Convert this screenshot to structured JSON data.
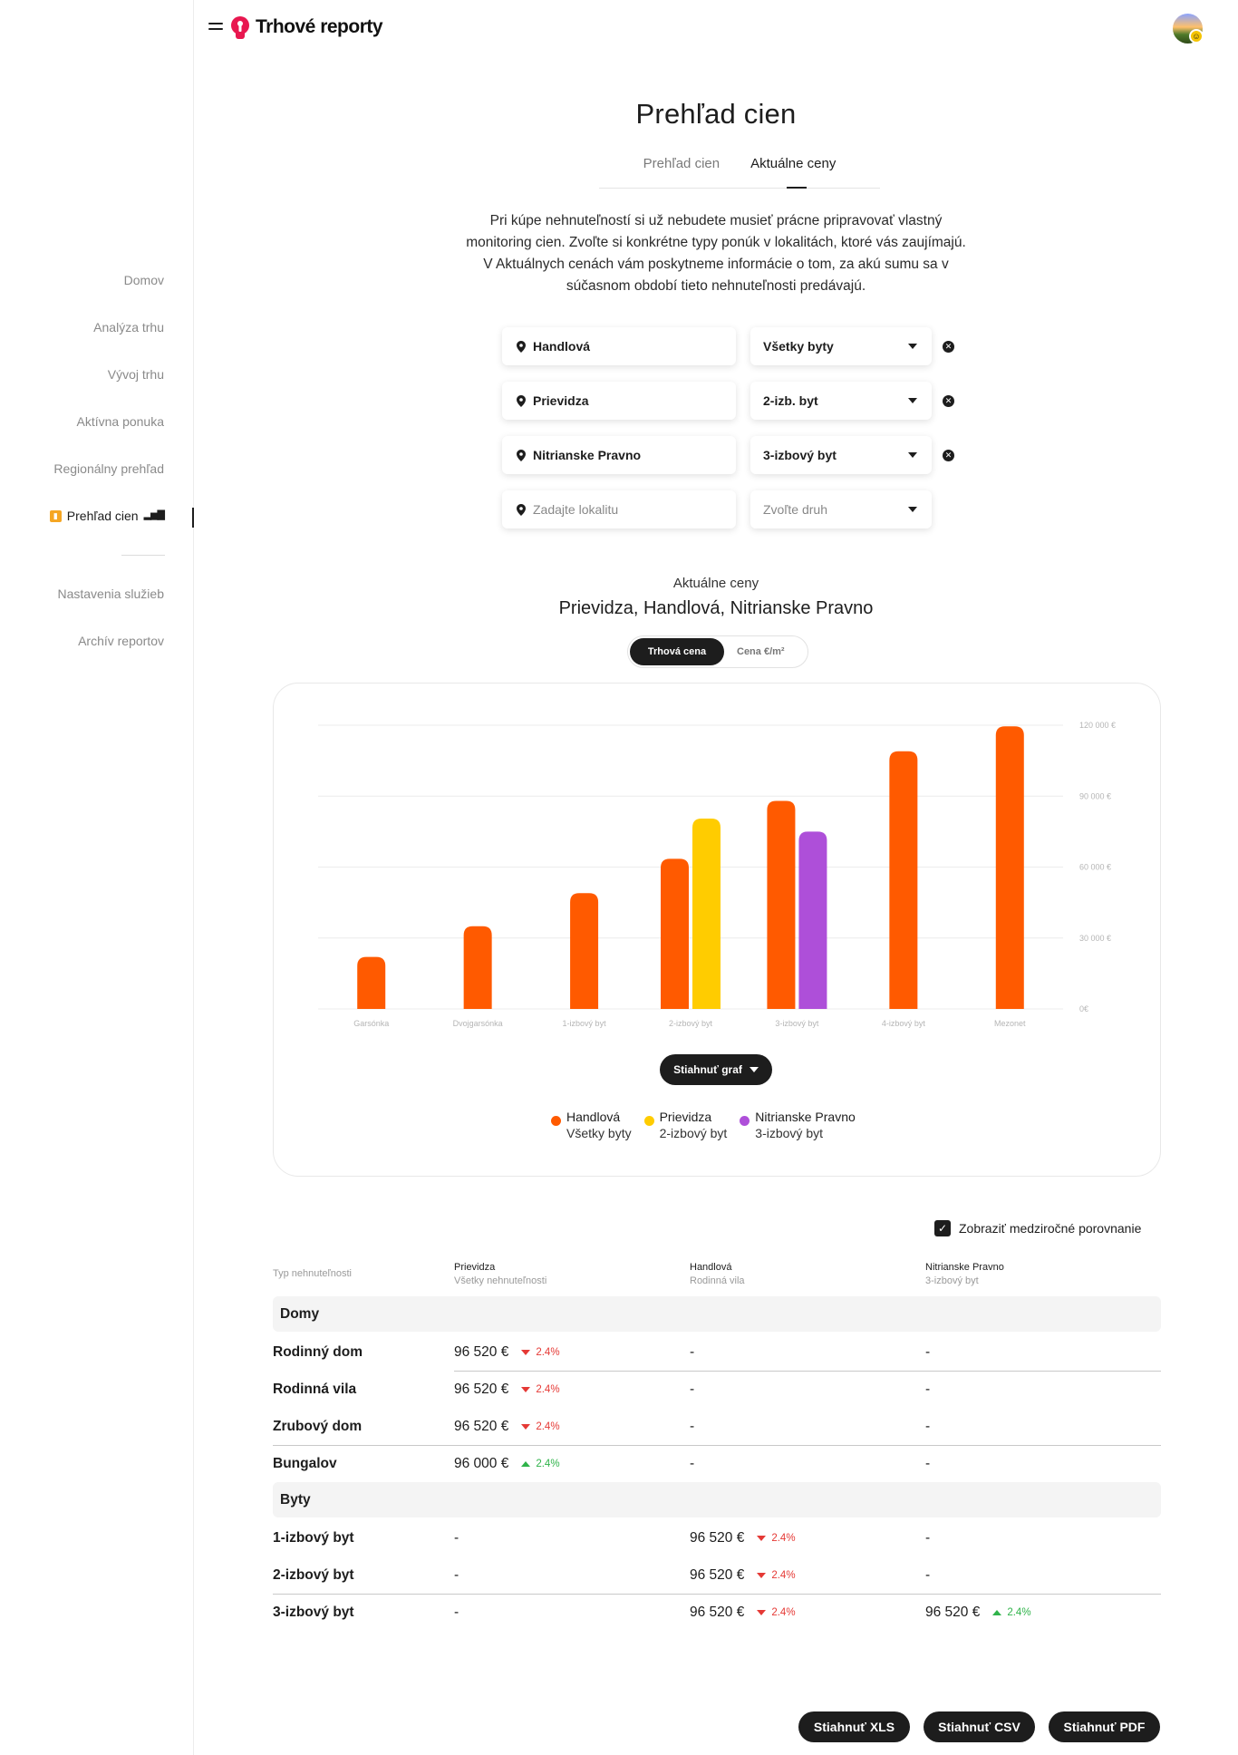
{
  "app": {
    "logo_text": "Trhové reporty",
    "brand_color": "#e8174f"
  },
  "sidebar": {
    "items": [
      {
        "label": "Domov"
      },
      {
        "label": "Analýza trhu"
      },
      {
        "label": "Vývoj trhu"
      },
      {
        "label": "Aktívna ponuka"
      },
      {
        "label": "Regionálny prehľad"
      },
      {
        "label": "Prehľad cien",
        "active": true
      }
    ],
    "secondary": [
      {
        "label": "Nastavenia služieb"
      },
      {
        "label": "Archív reportov"
      }
    ]
  },
  "page": {
    "title": "Prehľad cien",
    "tabs": [
      {
        "label": "Prehľad cien"
      },
      {
        "label": "Aktuálne ceny",
        "active": true
      }
    ],
    "intro": "Pri kúpe nehnuteľností si už nebudete musieť prácne pripravovať vlastný monitoring cien. Zvoľte si konkrétne typy ponúk v lokalitách, ktoré vás zaujímajú. V Aktuálnych cenách vám poskytneme informácie o tom, za akú sumu sa v súčasnom období tieto nehnuteľnosti predávajú."
  },
  "filters": [
    {
      "location": "Handlová",
      "type": "Všetky byty"
    },
    {
      "location": "Prievidza",
      "type": "2-izb. byt"
    },
    {
      "location": "Nitrianske Pravno",
      "type": "3-izbový byt"
    }
  ],
  "new_filter": {
    "location_placeholder": "Zadajte lokalitu",
    "type_placeholder": "Zvoľte druh"
  },
  "chart_header": {
    "subtitle": "Aktuálne ceny",
    "title": "Prievidza, Handlová, Nitrianske Pravno",
    "toggle": [
      {
        "label": "Trhová cena",
        "active": true
      },
      {
        "label": "Cena €/m²"
      }
    ],
    "download_label": "Stiahnuť graf"
  },
  "chart_data": {
    "type": "bar",
    "categories": [
      "Garsónka",
      "Dvojgarsónka",
      "1-izbový byt",
      "2-izbový byt",
      "3-izbový byt",
      "4-izbový byt",
      "Mezonet"
    ],
    "y_ticks": [
      "0€",
      "30 000 €",
      "60 000 €",
      "90 000 €",
      "120 000 €"
    ],
    "ylim": [
      0,
      120000
    ],
    "grid": true,
    "series": [
      {
        "location": "Handlová",
        "type": "Všetky byty",
        "color": "#ff5a00",
        "values": [
          22000,
          35000,
          49000,
          63500,
          88000,
          109000,
          119500
        ]
      },
      {
        "location": "Prievidza",
        "type": "2-izbový byt",
        "color": "#ffcc00",
        "values": [
          null,
          null,
          null,
          80500,
          null,
          null,
          null
        ]
      },
      {
        "location": "Nitrianske Pravno",
        "type": "3-izbový byt",
        "color": "#ae4fd9",
        "values": [
          null,
          null,
          null,
          null,
          75000,
          null,
          null
        ]
      }
    ]
  },
  "table": {
    "yoy_label": "Zobraziť medziročné porovnanie",
    "yoy_checked": true,
    "first_col_header": "Typ nehnuteľnosti",
    "columns": [
      {
        "location": "Prievidza",
        "type": "Všetky nehnuteľnosti"
      },
      {
        "location": "Handlová",
        "type": "Rodinná vila"
      },
      {
        "location": "Nitrianske Pravno",
        "type": "3-izbový byt"
      }
    ],
    "groups": [
      {
        "name": "Domy",
        "rows": [
          {
            "label": "Rodinný dom",
            "cells": [
              {
                "price": "96 520 €",
                "change": "2.4%",
                "dir": "down"
              },
              {
                "price": "-"
              },
              {
                "price": "-"
              }
            ]
          },
          {
            "label": "Rodinná vila",
            "cells": [
              {
                "price": "96 520 €",
                "change": "2.4%",
                "dir": "down"
              },
              {
                "price": "-"
              },
              {
                "price": "-"
              }
            ]
          },
          {
            "label": "Zrubový dom",
            "cells": [
              {
                "price": "96 520 €",
                "change": "2.4%",
                "dir": "down"
              },
              {
                "price": "-"
              },
              {
                "price": "-"
              }
            ]
          },
          {
            "label": "Bungalov",
            "cells": [
              {
                "price": "96 000 €",
                "change": "2.4%",
                "dir": "up"
              },
              {
                "price": "-"
              },
              {
                "price": "-"
              }
            ]
          }
        ]
      },
      {
        "name": "Byty",
        "rows": [
          {
            "label": "1-izbový byt",
            "cells": [
              {
                "price": "-"
              },
              {
                "price": "96 520 €",
                "change": "2.4%",
                "dir": "down"
              },
              {
                "price": "-"
              }
            ]
          },
          {
            "label": "2-izbový byt",
            "cells": [
              {
                "price": "-"
              },
              {
                "price": "96 520 €",
                "change": "2.4%",
                "dir": "down"
              },
              {
                "price": "-"
              }
            ]
          },
          {
            "label": "3-izbový byt",
            "cells": [
              {
                "price": "-"
              },
              {
                "price": "96 520 €",
                "change": "2.4%",
                "dir": "down"
              },
              {
                "price": "96 520 €",
                "change": "2.4%",
                "dir": "up"
              }
            ]
          }
        ]
      }
    ]
  },
  "exports": [
    {
      "label": "Stiahnuť XLS"
    },
    {
      "label": "Stiahnuť CSV"
    },
    {
      "label": "Stiahnuť PDF"
    }
  ]
}
